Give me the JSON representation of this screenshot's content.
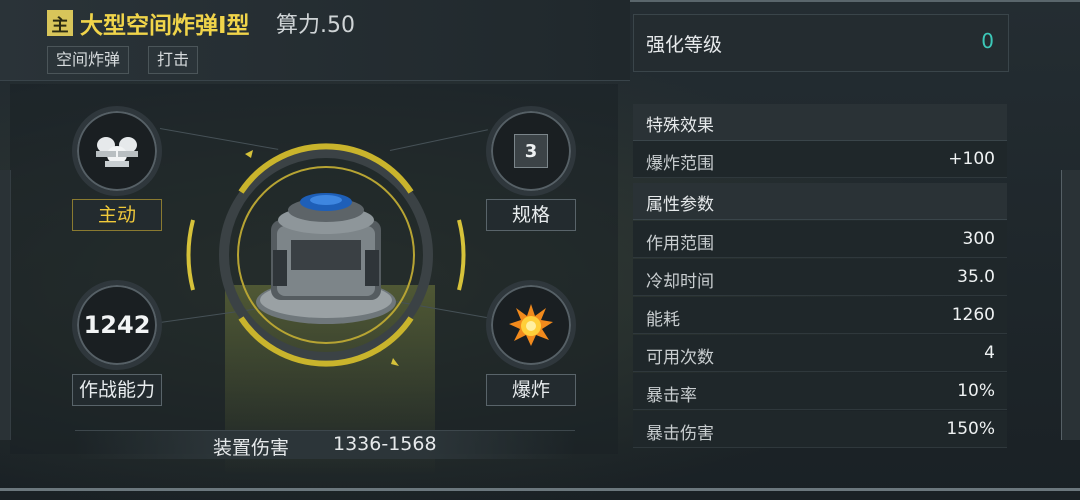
{
  "header": {
    "badge": "主",
    "title": "大型空间炸弹I型",
    "power": "算力.50",
    "tags": [
      "空间炸弹",
      "打击"
    ]
  },
  "item": {
    "circles": {
      "mode_label": "主动",
      "spec_value": "3",
      "spec_label": "规格",
      "combat_value": "1242",
      "combat_label": "作战能力",
      "type_label": "爆炸"
    },
    "damage": {
      "label": "装置伤害",
      "value": "1336-1568"
    }
  },
  "stats": {
    "enhance_label": "强化等级",
    "enhance_value": "0",
    "special": {
      "title": "特殊效果",
      "rows": [
        {
          "k": "爆炸范围",
          "v": "+100"
        }
      ]
    },
    "attributes": {
      "title": "属性参数",
      "rows": [
        {
          "k": "作用范围",
          "v": "300"
        },
        {
          "k": "冷却时间",
          "v": "35.0"
        },
        {
          "k": "能耗",
          "v": "1260"
        },
        {
          "k": "可用次数",
          "v": "4"
        },
        {
          "k": "暴击率",
          "v": "10%"
        },
        {
          "k": "暴击伤害",
          "v": "150%"
        }
      ]
    }
  },
  "colors": {
    "accent_gold": "#f0d44a",
    "accent_teal": "#3cc8b8",
    "ring_gold": "#c9b42c"
  },
  "icons": {
    "mode": "bell-cluster-icon",
    "type": "explosion-icon",
    "item": "space-bomb-icon"
  }
}
